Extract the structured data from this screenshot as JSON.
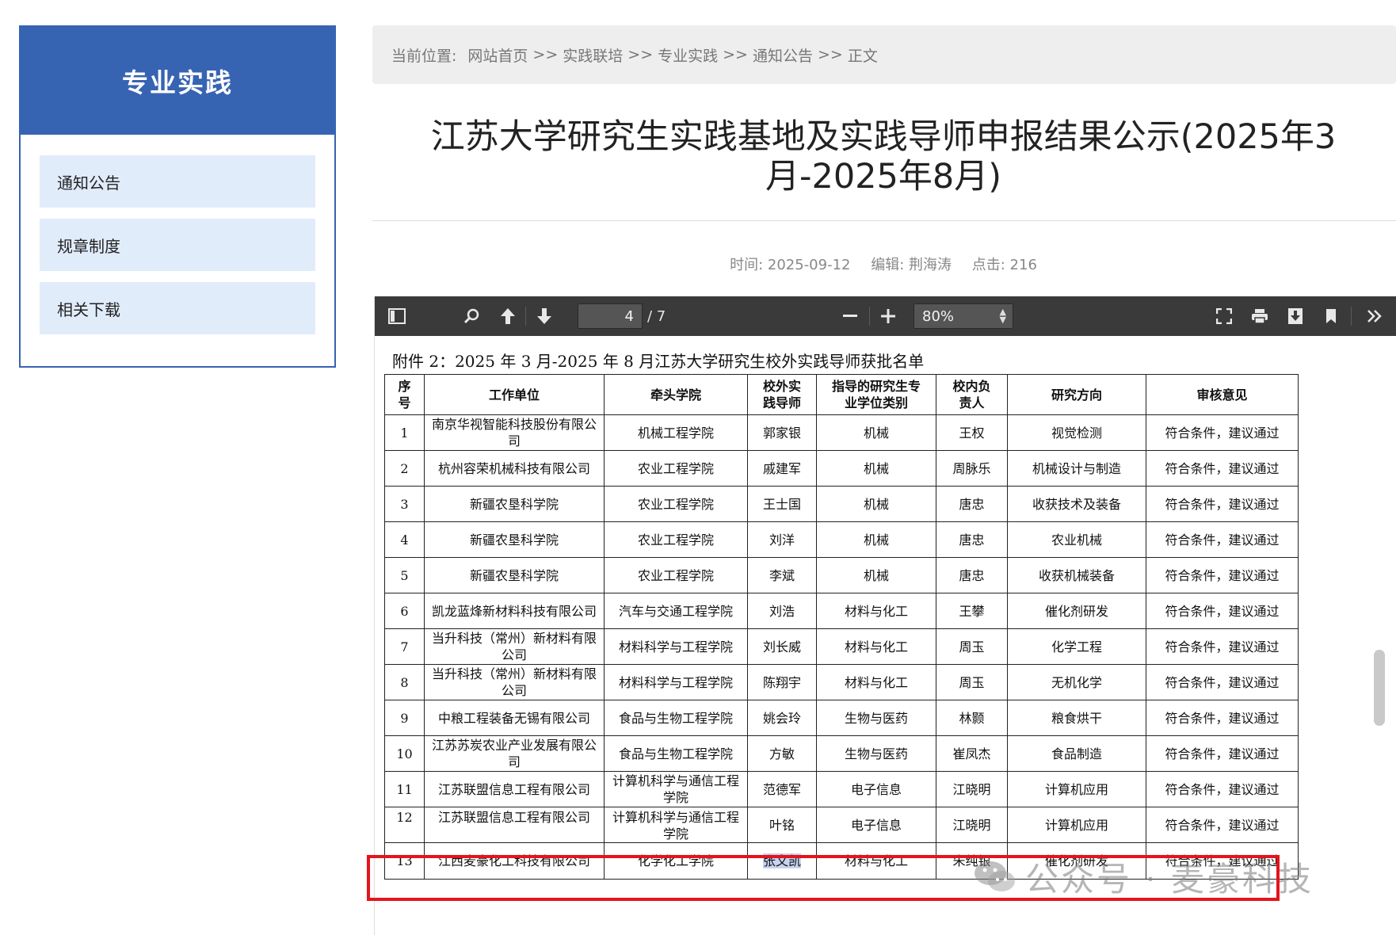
{
  "sidebar": {
    "title": "专业实践",
    "items": [
      {
        "label": "通知公告"
      },
      {
        "label": "规章制度"
      },
      {
        "label": "相关下载"
      }
    ]
  },
  "breadcrumb": {
    "prefix": "当前位置:",
    "separator": ">>",
    "links": [
      "网站首页",
      "实践联培",
      "专业实践",
      "通知公告",
      "正文"
    ]
  },
  "article": {
    "title": "江苏大学研究生实践基地及实践导师申报结果公示(2025年3月-2025年8月)",
    "time": "时间: 2025-09-12",
    "editor": "编辑: 荆海涛",
    "clicks": "点击: 216"
  },
  "viewer": {
    "page_current": "4",
    "page_total": "/ 7",
    "zoom": "80%",
    "icons": [
      "sidebar-toggle-icon",
      "search-icon",
      "previous-page-icon",
      "next-page-icon",
      "zoom-out-icon",
      "zoom-in-icon",
      "fullscreen-icon",
      "print-icon",
      "download-icon",
      "bookmark-icon",
      "more-tools-icon"
    ]
  },
  "document": {
    "heading": "附件 2：2025 年 3 月-2025 年 8 月江苏大学研究生校外实践导师获批名单",
    "columns": [
      "序号",
      "工作单位",
      "牵头学院",
      "校外实践导师",
      "指导的研究生专业学位类别",
      "校内负责人",
      "研究方向",
      "审核意见"
    ],
    "rows": [
      [
        "1",
        "南京华视智能科技股份有限公司",
        "机械工程学院",
        "郭家银",
        "机械",
        "王权",
        "视觉检测",
        "符合条件，建议通过"
      ],
      [
        "2",
        "杭州容荣机械科技有限公司",
        "农业工程学院",
        "戚建军",
        "机械",
        "周脉乐",
        "机械设计与制造",
        "符合条件，建议通过"
      ],
      [
        "3",
        "新疆农垦科学院",
        "农业工程学院",
        "王士国",
        "机械",
        "唐忠",
        "收获技术及装备",
        "符合条件，建议通过"
      ],
      [
        "4",
        "新疆农垦科学院",
        "农业工程学院",
        "刘洋",
        "机械",
        "唐忠",
        "农业机械",
        "符合条件，建议通过"
      ],
      [
        "5",
        "新疆农垦科学院",
        "农业工程学院",
        "李斌",
        "机械",
        "唐忠",
        "收获机械装备",
        "符合条件，建议通过"
      ],
      [
        "6",
        "凯龙蓝烽新材料科技有限公司",
        "汽车与交通工程学院",
        "刘浩",
        "材料与化工",
        "王攀",
        "催化剂研发",
        "符合条件，建议通过"
      ],
      [
        "7",
        "当升科技（常州）新材料有限公司",
        "材料科学与工程学院",
        "刘长威",
        "材料与化工",
        "周玉",
        "化学工程",
        "符合条件，建议通过"
      ],
      [
        "8",
        "当升科技（常州）新材料有限公司",
        "材料科学与工程学院",
        "陈翔宇",
        "材料与化工",
        "周玉",
        "无机化学",
        "符合条件，建议通过"
      ],
      [
        "9",
        "中粮工程装备无锡有限公司",
        "食品与生物工程学院",
        "姚会玲",
        "生物与医药",
        "林颢",
        "粮食烘干",
        "符合条件，建议通过"
      ],
      [
        "10",
        "江苏苏炭农业产业发展有限公司",
        "食品与生物工程学院",
        "方敏",
        "生物与医药",
        "崔凤杰",
        "食品制造",
        "符合条件，建议通过"
      ],
      [
        "11",
        "江苏联盟信息工程有限公司",
        "计算机科学与通信工程学院",
        "范德军",
        "电子信息",
        "江晓明",
        "计算机应用",
        "符合条件，建议通过"
      ],
      [
        "12",
        "江苏联盟信息工程有限公司",
        "计算机科学与通信工程学院",
        "叶铭",
        "电子信息",
        "江晓明",
        "计算机应用",
        "符合条件，建议通过"
      ],
      [
        "13",
        "江西麦豪化工科技有限公司",
        "化学化工学院",
        "张文凯",
        "材料与化工",
        "朱纯银",
        "催化剂研发",
        "符合条件，建议通过"
      ]
    ]
  },
  "watermark": "公众号 · 麦豪科技",
  "colors": {
    "sidebar_blue": "#3763b3",
    "sidebar_item_bg": "#e1ecfb",
    "toolbar_bg": "#3a3a3a",
    "highlight_box": "#e4141b",
    "selection": "#c6d4f0"
  }
}
